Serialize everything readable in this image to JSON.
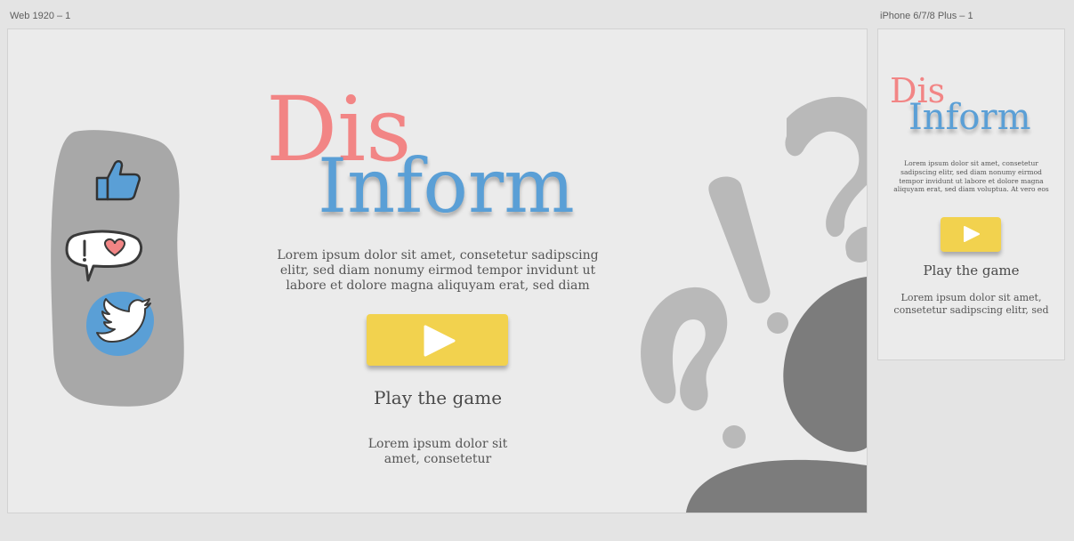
{
  "artboards": {
    "web_label": "Web 1920 – 1",
    "phone_label": "iPhone 6/7/8 Plus – 1"
  },
  "logo": {
    "dis": "Dis",
    "inform": "Inform"
  },
  "web": {
    "description_lines": [
      "Lorem ipsum dolor sit amet, consetetur sadipscing",
      "elitr, sed diam nonumy eirmod tempor invidunt ut",
      "labore et dolore magna aliquyam erat, sed diam"
    ],
    "play_label": "Play the game",
    "footer_lines": [
      "Lorem ipsum dolor sit",
      "amet, consetetur"
    ]
  },
  "phone": {
    "description_lines": [
      "Lorem ipsum dolor sit amet, consetetur",
      "sadipscing elitr, sed diam nonumy eirmod",
      "tempor invidunt ut labore et dolore magna",
      "aliquyam erat, sed diam voluptua. At vero eos"
    ],
    "play_label": "Play the game",
    "footer_lines": [
      "Lorem ipsum dolor sit amet,",
      "consetetur sadipscing elitr, sed"
    ]
  },
  "colors": {
    "dis": "#f28585",
    "inform": "#5a9fd6",
    "button": "#f2d24e",
    "side_panel": "#a8a8a8",
    "deco_light": "#b9b9b9",
    "deco_dark": "#7c7c7c"
  },
  "icons": [
    "thumbs-up-icon",
    "speech-bubble-heart-icon",
    "twitter-bird-icon",
    "play-icon",
    "question-mark-icon",
    "exclamation-mark-icon"
  ]
}
